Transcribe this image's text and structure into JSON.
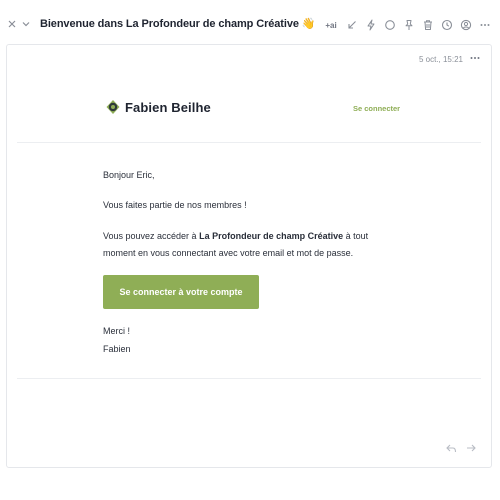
{
  "header": {
    "subject": "Bienvenue dans La Profondeur de champ Créative 👋",
    "ai_label": "+ai",
    "tools": [
      "close-icon",
      "chevron-down-icon",
      "reply-arrow-icon",
      "bolt-icon",
      "circle-icon",
      "pin-icon",
      "trash-icon",
      "clock-icon",
      "contact-icon",
      "more-icon"
    ]
  },
  "message": {
    "date": "5 oct., 15:21",
    "brand": "Fabien Beilhe",
    "login_link": "Se connecter",
    "greeting": "Bonjour Eric,",
    "member_text": "Vous faites partie de nos membres !",
    "access_prefix": "Vous pouvez accéder à ",
    "access_bold": "La Profondeur de champ Créative",
    "access_suffix": " à tout",
    "access_line2": "moment en vous connectant avec votre email et mot de passe.",
    "cta_label": "Se connecter à votre compte",
    "thanks": "Merci !",
    "signature": "Fabien"
  },
  "colors": {
    "accent": "#8fae56",
    "text": "#1f2430",
    "muted": "#8a8f98",
    "logo_dark": "#2f3a3a",
    "logo_green": "#8fae56"
  }
}
